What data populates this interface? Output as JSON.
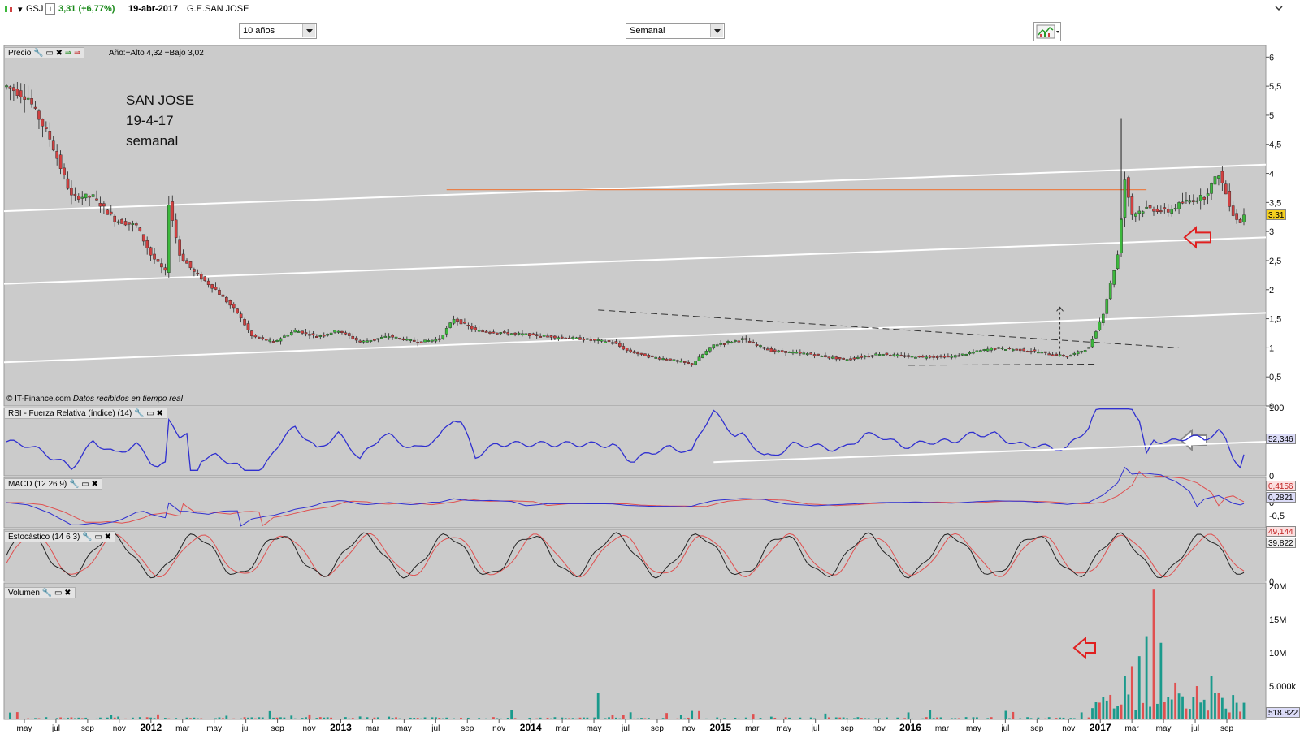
{
  "header": {
    "symbol": "GSJ",
    "info_icon": "i",
    "price_change": "3,31 (+6,77%)",
    "date": "19-abr-2017",
    "company": "G.E.SAN JOSE"
  },
  "toolbar": {
    "range_select": "10 años",
    "interval_select": "Semanal"
  },
  "annotation": {
    "line1": "SAN JOSE",
    "line2": "19-4-17",
    "line3": "semanal"
  },
  "panels": {
    "price": {
      "label": "Precio",
      "info": "Año:+Alto 4,32 +Bajo 3,02"
    },
    "rsi": {
      "label": "RSI - Fuerza Relativa (índice) (14)",
      "value": "52,346"
    },
    "macd": {
      "label": "MACD (12 26 9)",
      "value1": "0,4156",
      "value2": "0,2821"
    },
    "stoch": {
      "label": "Estocástico (14 6 3)",
      "value1": "49,144",
      "value2": "39,822"
    },
    "volume": {
      "label": "Volumen",
      "value": "518.822"
    }
  },
  "copyright": {
    "source": "© IT-Finance.com",
    "note": "Datos recibidos en tiempo real"
  },
  "colors": {
    "up": "#3cb83c",
    "down": "#d04040",
    "vol_up": "#1a9a8c",
    "vol_down": "#e05050",
    "rsi": "#3030d0",
    "macd": "#3030d0",
    "signal": "#e05050",
    "bg": "#cbcbcb",
    "trend": "#ffffff",
    "resistance": "#e8804a",
    "arrow_red": "#e02020"
  },
  "chart_data": {
    "type": "candlestick",
    "price_axis": {
      "ticks": [
        "0",
        "0,5",
        "1",
        "1,5",
        "2",
        "2,5",
        "3",
        "3,5",
        "4",
        "4,5",
        "5",
        "5,5",
        "6"
      ],
      "ylim": [
        0,
        6.2
      ]
    },
    "last_price": "3,31",
    "x_ticks": [
      {
        "label": "may",
        "bold": false
      },
      {
        "label": "jul",
        "bold": false
      },
      {
        "label": "sep",
        "bold": false
      },
      {
        "label": "nov",
        "bold": false
      },
      {
        "label": "2012",
        "bold": true
      },
      {
        "label": "mar",
        "bold": false
      },
      {
        "label": "may",
        "bold": false
      },
      {
        "label": "jul",
        "bold": false
      },
      {
        "label": "sep",
        "bold": false
      },
      {
        "label": "nov",
        "bold": false
      },
      {
        "label": "2013",
        "bold": true
      },
      {
        "label": "mar",
        "bold": false
      },
      {
        "label": "may",
        "bold": false
      },
      {
        "label": "jul",
        "bold": false
      },
      {
        "label": "sep",
        "bold": false
      },
      {
        "label": "nov",
        "bold": false
      },
      {
        "label": "2014",
        "bold": true
      },
      {
        "label": "mar",
        "bold": false
      },
      {
        "label": "may",
        "bold": false
      },
      {
        "label": "jul",
        "bold": false
      },
      {
        "label": "sep",
        "bold": false
      },
      {
        "label": "nov",
        "bold": false
      },
      {
        "label": "2015",
        "bold": true
      },
      {
        "label": "mar",
        "bold": false
      },
      {
        "label": "may",
        "bold": false
      },
      {
        "label": "jul",
        "bold": false
      },
      {
        "label": "sep",
        "bold": false
      },
      {
        "label": "nov",
        "bold": false
      },
      {
        "label": "2016",
        "bold": true
      },
      {
        "label": "mar",
        "bold": false
      },
      {
        "label": "may",
        "bold": false
      },
      {
        "label": "jul",
        "bold": false
      },
      {
        "label": "sep",
        "bold": false
      },
      {
        "label": "nov",
        "bold": false
      },
      {
        "label": "2017",
        "bold": true
      },
      {
        "label": "mar",
        "bold": false
      },
      {
        "label": "may",
        "bold": false
      },
      {
        "label": "jul",
        "bold": false
      },
      {
        "label": "sep",
        "bold": false
      }
    ],
    "price_path": [
      [
        0,
        5.5
      ],
      [
        6,
        5.3
      ],
      [
        12,
        4.6
      ],
      [
        18,
        3.6
      ],
      [
        24,
        3.6
      ],
      [
        30,
        3.2
      ],
      [
        36,
        3.1
      ],
      [
        40,
        2.6
      ],
      [
        44,
        2.3
      ],
      [
        45,
        3.5
      ],
      [
        48,
        2.6
      ],
      [
        52,
        2.3
      ],
      [
        58,
        2.0
      ],
      [
        64,
        1.6
      ],
      [
        68,
        1.2
      ],
      [
        74,
        1.1
      ],
      [
        80,
        1.3
      ],
      [
        86,
        1.2
      ],
      [
        92,
        1.3
      ],
      [
        98,
        1.1
      ],
      [
        106,
        1.2
      ],
      [
        114,
        1.1
      ],
      [
        120,
        1.15
      ],
      [
        124,
        1.5
      ],
      [
        130,
        1.3
      ],
      [
        140,
        1.25
      ],
      [
        150,
        1.2
      ],
      [
        160,
        1.15
      ],
      [
        168,
        1.1
      ],
      [
        172,
        0.95
      ],
      [
        178,
        0.85
      ],
      [
        184,
        0.8
      ],
      [
        190,
        0.72
      ],
      [
        196,
        1.05
      ],
      [
        204,
        1.15
      ],
      [
        212,
        0.95
      ],
      [
        222,
        0.9
      ],
      [
        232,
        0.8
      ],
      [
        242,
        0.9
      ],
      [
        250,
        0.85
      ],
      [
        262,
        0.85
      ],
      [
        274,
        1.0
      ],
      [
        284,
        0.95
      ],
      [
        294,
        0.85
      ],
      [
        300,
        1.0
      ],
      [
        304,
        1.6
      ],
      [
        308,
        2.6
      ],
      [
        310,
        3.9
      ],
      [
        312,
        3.3
      ],
      [
        316,
        3.4
      ],
      [
        322,
        3.35
      ],
      [
        326,
        3.5
      ],
      [
        332,
        3.6
      ],
      [
        336,
        4.0
      ],
      [
        340,
        3.3
      ],
      [
        342,
        3.15
      ],
      [
        343,
        3.31
      ]
    ],
    "volume_axis": {
      "ticks": [
        "5.000k",
        "10M",
        "15M",
        "20M"
      ]
    },
    "volume_spikes": [
      [
        318,
        19.5
      ],
      [
        316,
        12.5
      ],
      [
        314,
        9.5
      ],
      [
        320,
        11.5
      ],
      [
        312,
        8.0
      ],
      [
        310,
        6.5
      ],
      [
        324,
        5.5
      ],
      [
        330,
        5.0
      ],
      [
        334,
        6.5
      ],
      [
        336,
        4.0
      ],
      [
        164,
        4.0
      ]
    ],
    "rsi_axis": {
      "ticks": [
        "0",
        "100"
      ]
    },
    "macd_axis": {
      "ticks": [
        "0",
        "-0,5"
      ]
    },
    "stoch_axis": {
      "ticks": [
        "0",
        "100"
      ]
    }
  }
}
